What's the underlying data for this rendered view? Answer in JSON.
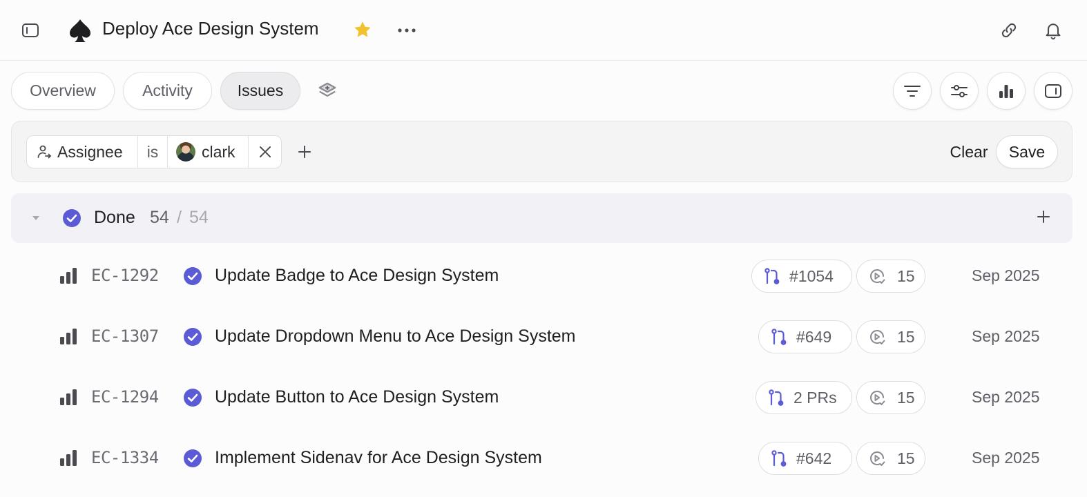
{
  "header": {
    "title": "Deploy Ace Design System",
    "icons": [
      "sidebar-toggle-icon",
      "spade-icon",
      "star-icon",
      "more-icon",
      "link-icon",
      "bell-icon"
    ],
    "star_color": "#f2c12e"
  },
  "tabs": [
    {
      "label": "Overview",
      "active": false
    },
    {
      "label": "Activity",
      "active": false
    },
    {
      "label": "Issues",
      "active": true
    }
  ],
  "view_controls": [
    "filter-icon",
    "display-options-icon",
    "chart-icon",
    "side-panel-icon"
  ],
  "filter": {
    "attribute": "Assignee",
    "operator": "is",
    "value": "clark",
    "clear_label": "Clear",
    "save_label": "Save"
  },
  "group": {
    "name": "Done",
    "count": "54",
    "separator": "/",
    "total": "54",
    "status_color": "#5b5bd6"
  },
  "issues": [
    {
      "id": "EC-1292",
      "title": "Update Badge to Ace Design System",
      "pr": "#1054",
      "estimate": "15",
      "date": "Sep 2025"
    },
    {
      "id": "EC-1307",
      "title": "Update Dropdown Menu to Ace Design System",
      "pr": "#649",
      "estimate": "15",
      "date": "Sep 2025"
    },
    {
      "id": "EC-1294",
      "title": "Update Button to Ace Design System",
      "pr": "2 PRs",
      "estimate": "15",
      "date": "Sep 2025"
    },
    {
      "id": "EC-1334",
      "title": "Implement Sidenav for Ace Design System",
      "pr": "#642",
      "estimate": "15",
      "date": "Sep 2025"
    }
  ]
}
